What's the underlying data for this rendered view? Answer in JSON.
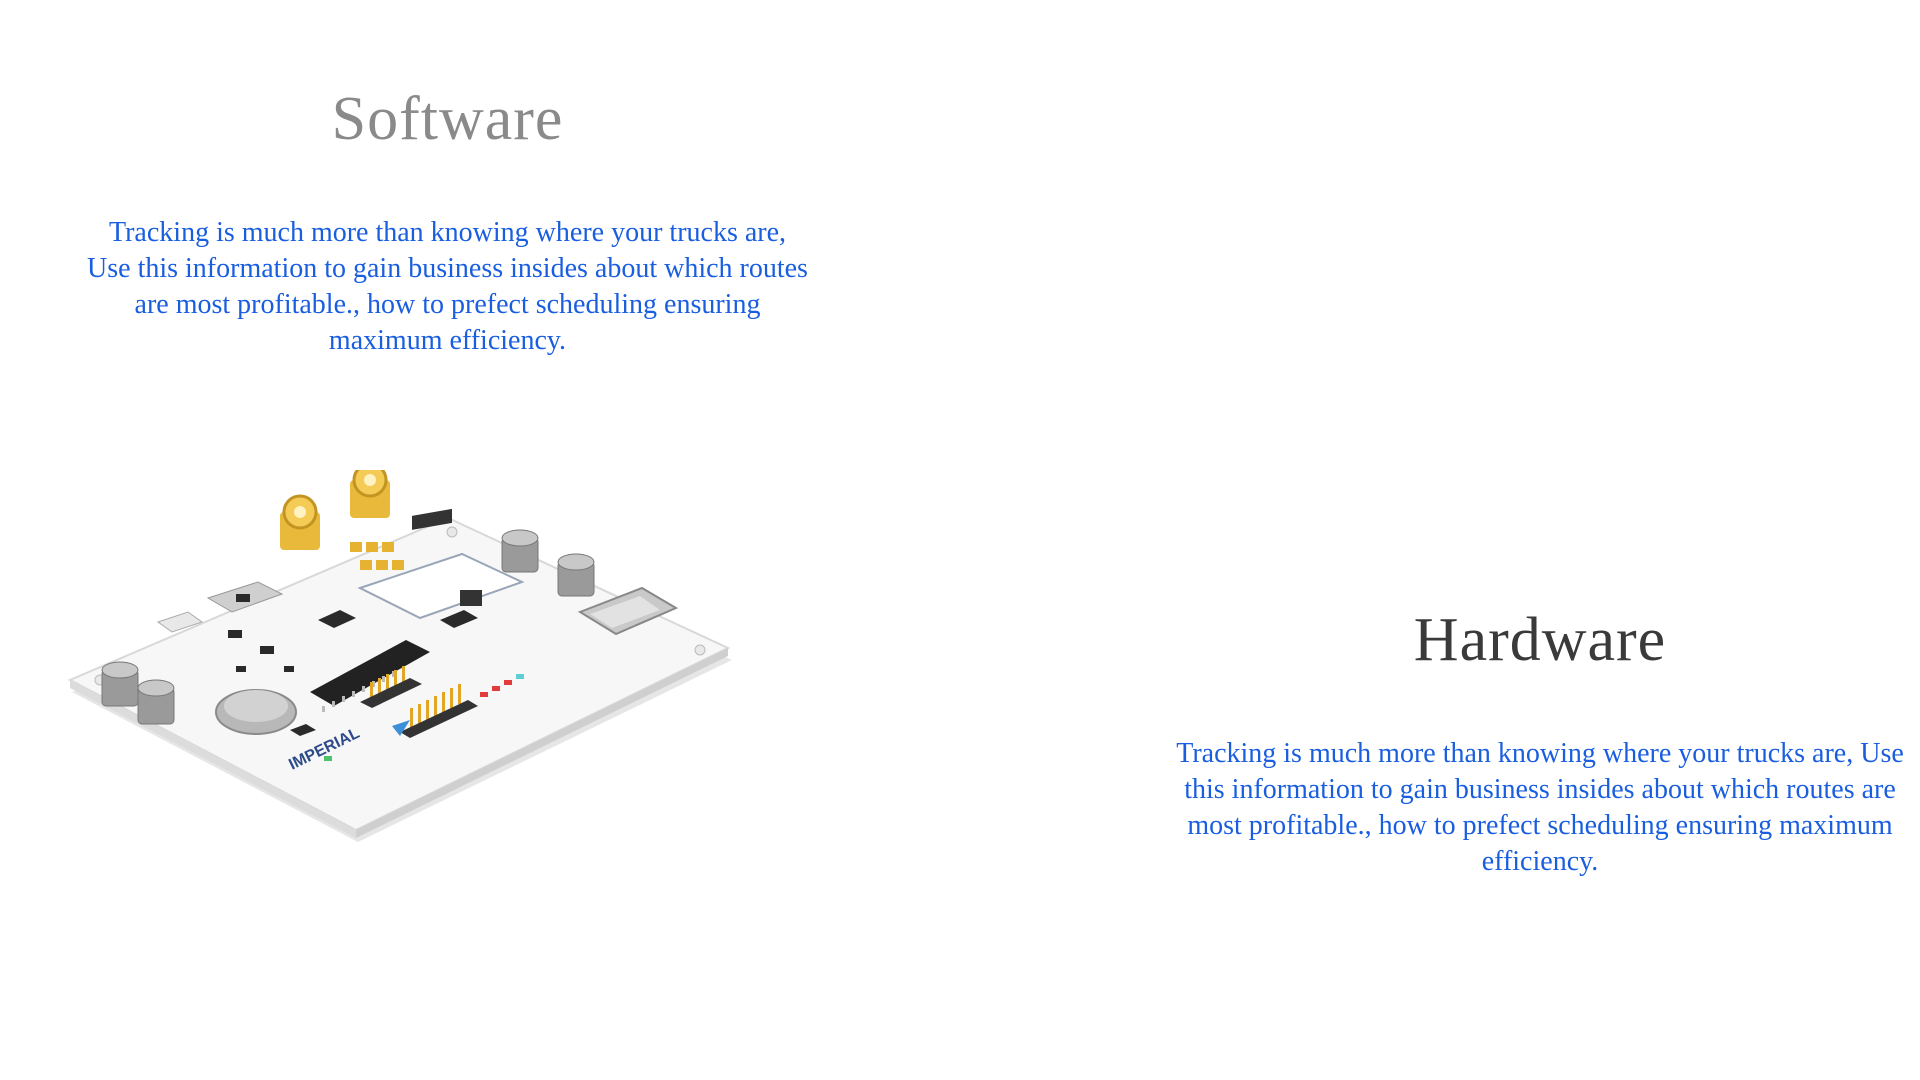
{
  "software": {
    "title": "Software",
    "body": "Tracking is much more than knowing where your trucks are, Use this information to gain business insides about which routes are most profitable., how to prefect scheduling ensuring maximum efficiency."
  },
  "hardware": {
    "title": "Hardware",
    "body": "Tracking is much more than knowing where your trucks are, Use this information to gain business insides about which routes are most profitable., how to prefect scheduling ensuring maximum efficiency."
  },
  "board": {
    "brand": "IMPERIAL"
  },
  "colors": {
    "body_text": "#1a5ee0",
    "software_title": "#8a8a8a",
    "hardware_title": "#3a3a3a"
  }
}
